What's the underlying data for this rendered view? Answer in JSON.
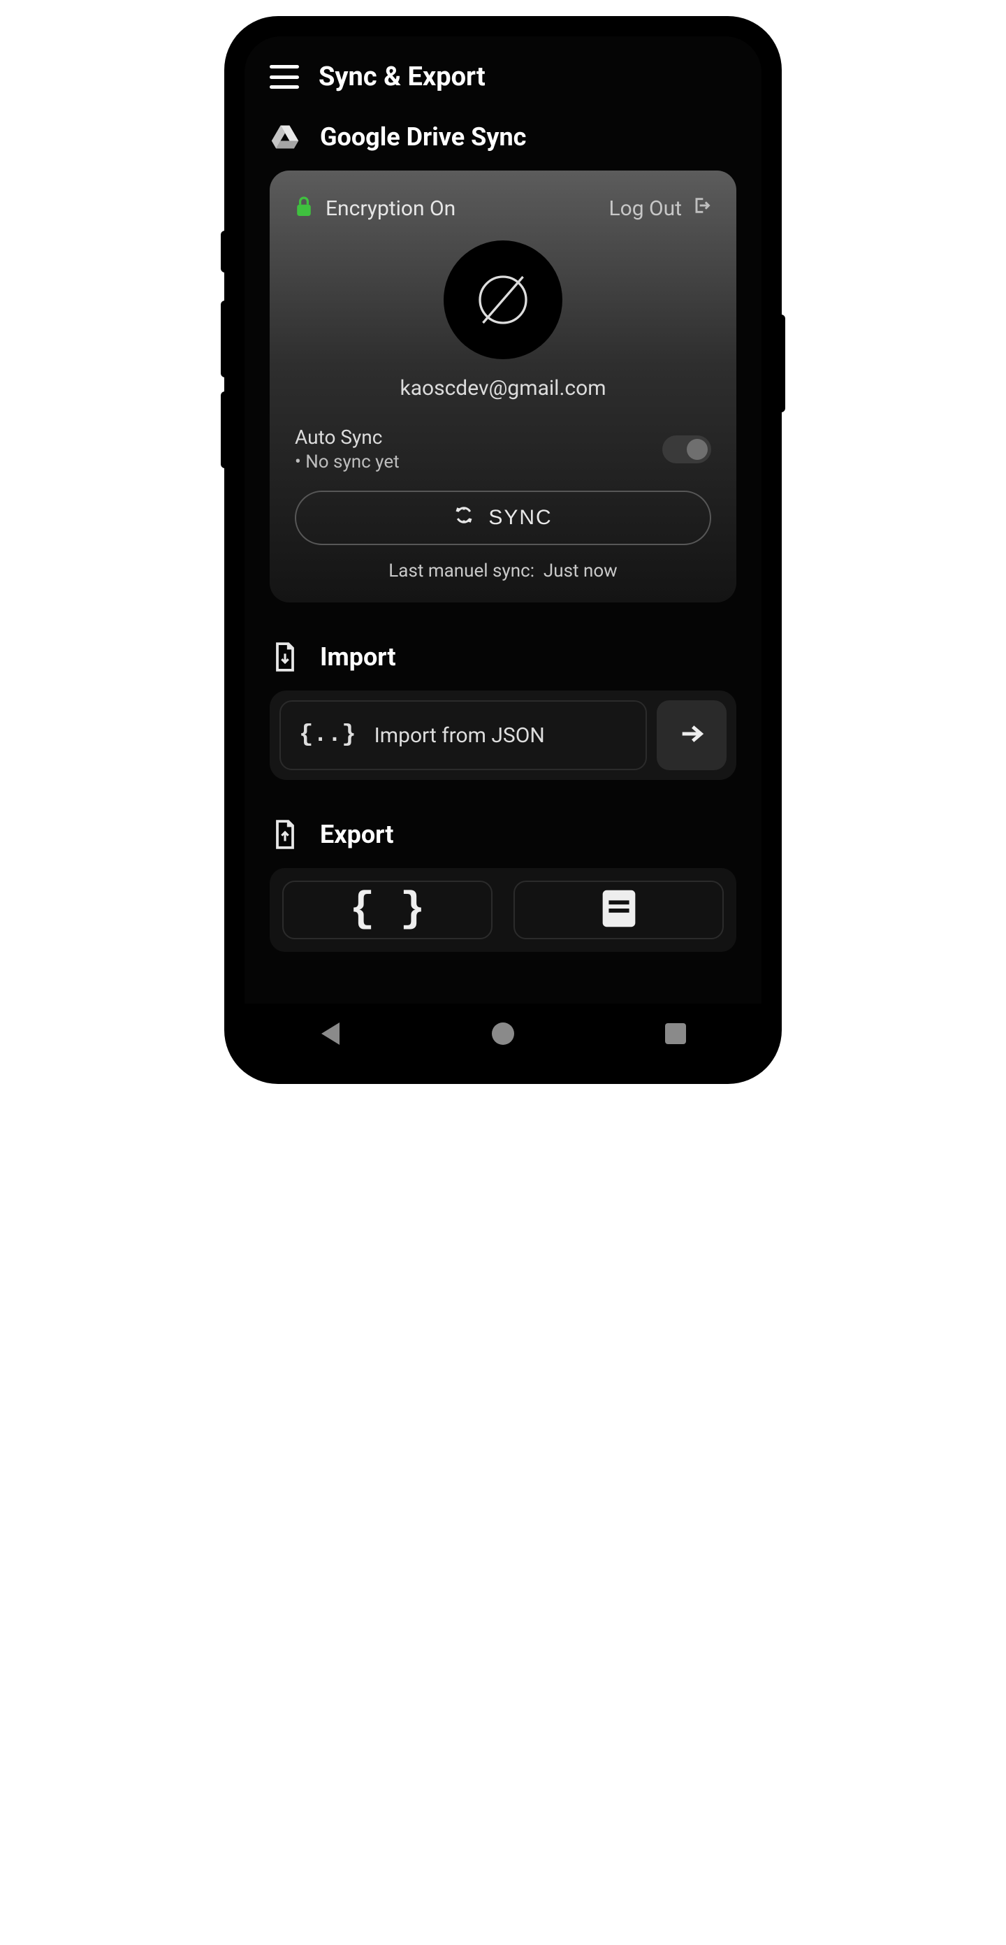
{
  "appbar": {
    "title": "Sync & Export"
  },
  "drive": {
    "section_title": "Google Drive Sync",
    "encryption_label": "Encryption On",
    "logout_label": "Log Out",
    "email": "kaoscdev@gmail.com",
    "autosync_label": "Auto Sync",
    "autosync_status": "• No sync yet",
    "sync_button": "SYNC",
    "last_sync_prefix": "Last manuel sync:",
    "last_sync_value": "Just now"
  },
  "import_section": {
    "title": "Import",
    "json_label": "Import from JSON"
  },
  "export_section": {
    "title": "Export"
  },
  "colors": {
    "accent_green": "#3fc13f"
  }
}
